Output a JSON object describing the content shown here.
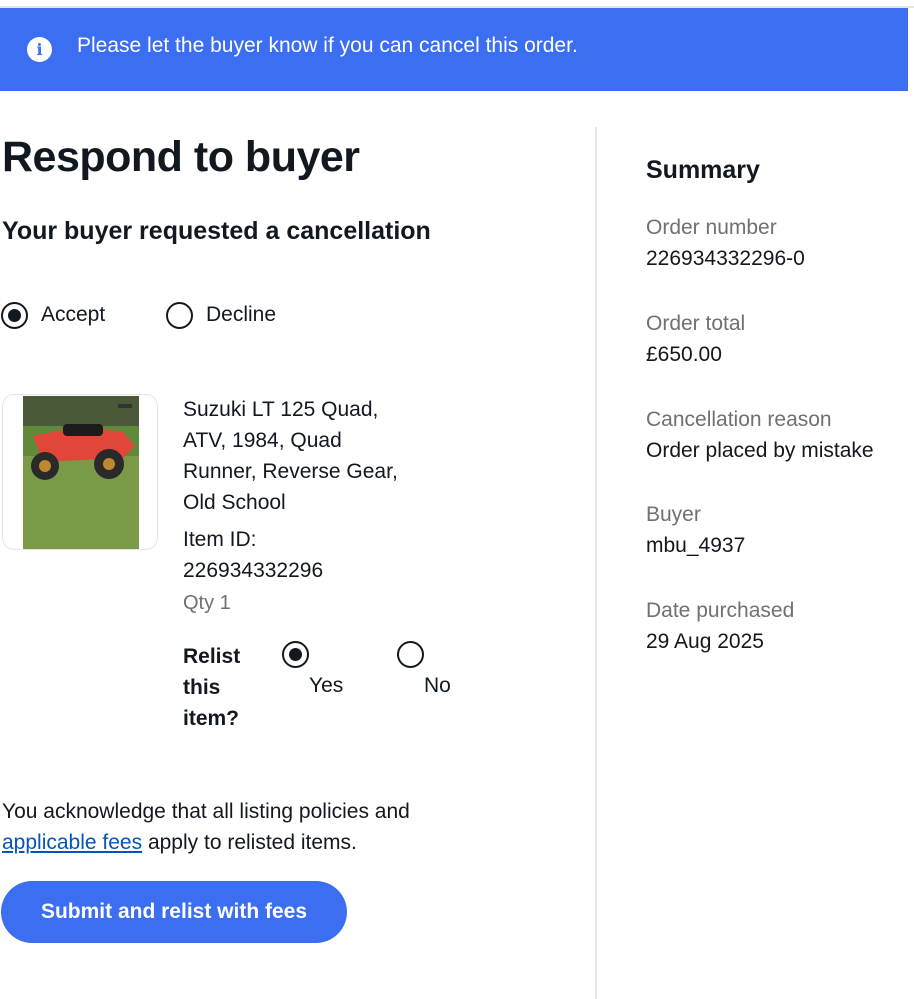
{
  "banner": {
    "icon": "info-icon",
    "message": "Please let the buyer know if you can cancel this order."
  },
  "page": {
    "title": "Respond to buyer",
    "subtitle": "Your buyer requested a cancellation"
  },
  "response_options": [
    {
      "label": "Accept",
      "selected": true
    },
    {
      "label": "Decline",
      "selected": false
    }
  ],
  "item": {
    "title": "Suzuki LT 125 Quad, ATV, 1984, Quad Runner, Reverse Gear, Old School",
    "item_id_label": "Item ID:",
    "item_id": "226934332296",
    "qty": "Qty 1"
  },
  "relist": {
    "question": "Relist this item?",
    "options": [
      {
        "label": "Yes",
        "selected": true
      },
      {
        "label": "No",
        "selected": false
      }
    ]
  },
  "acknowledgement": {
    "prefix": "You acknowledge that all listing policies and ",
    "link_text": "applicable fees",
    "suffix": " apply to relisted items."
  },
  "submit_label": "Submit and relist with fees",
  "summary": {
    "title": "Summary",
    "order_number_label": "Order number",
    "order_number": "226934332296-0",
    "order_total_label": "Order total",
    "order_total": "£650.00",
    "cancellation_reason_label": "Cancellation reason",
    "cancellation_reason": "Order placed by mistake",
    "buyer_label": "Buyer",
    "buyer": "mbu_4937",
    "date_purchased_label": "Date purchased",
    "date_purchased": "29 Aug 2025"
  },
  "colors": {
    "accent": "#3b6ef0",
    "link": "#0654ba",
    "muted_text": "#707070"
  }
}
